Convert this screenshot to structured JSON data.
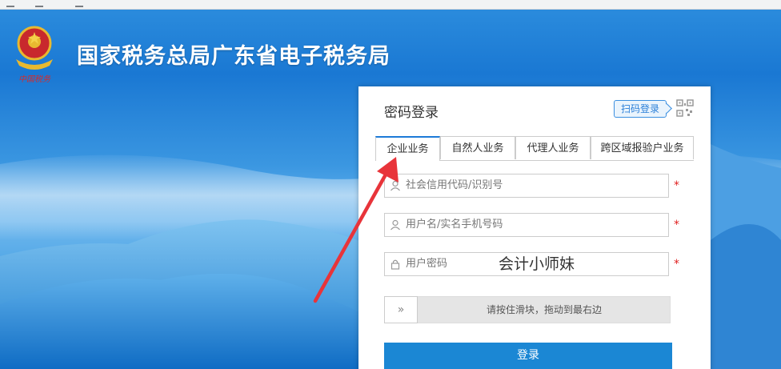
{
  "site": {
    "title": "国家税务总局广东省电子税务局",
    "emblem_caption": "中国税务"
  },
  "login": {
    "panel_title": "密码登录",
    "qr_tip": "扫码登录",
    "tabs": [
      {
        "label": "企业业务",
        "active": true
      },
      {
        "label": "自然人业务",
        "active": false
      },
      {
        "label": "代理人业务",
        "active": false
      },
      {
        "label": "跨区域报验户业务",
        "active": false
      }
    ],
    "fields": {
      "credit_code": {
        "placeholder": "社会信用代码/识别号",
        "required_mark": "*"
      },
      "username": {
        "placeholder": "用户名/实名手机号码",
        "required_mark": "*"
      },
      "password": {
        "placeholder": "用户密码",
        "required_mark": "*",
        "overlay_text": "会计小师妹"
      }
    },
    "slider": {
      "handle": "»",
      "hint": "请按住滑块，拖动到最右边"
    },
    "submit_label": "登录"
  },
  "colors": {
    "primary": "#1b87d4",
    "tab_active_border": "#1d7ad8",
    "required": "#e02020",
    "annotation_arrow": "#e8343a"
  },
  "icons": {
    "user": "user-icon",
    "lock": "lock-icon",
    "qr": "qr-code-icon",
    "emblem": "national-emblem-icon"
  }
}
